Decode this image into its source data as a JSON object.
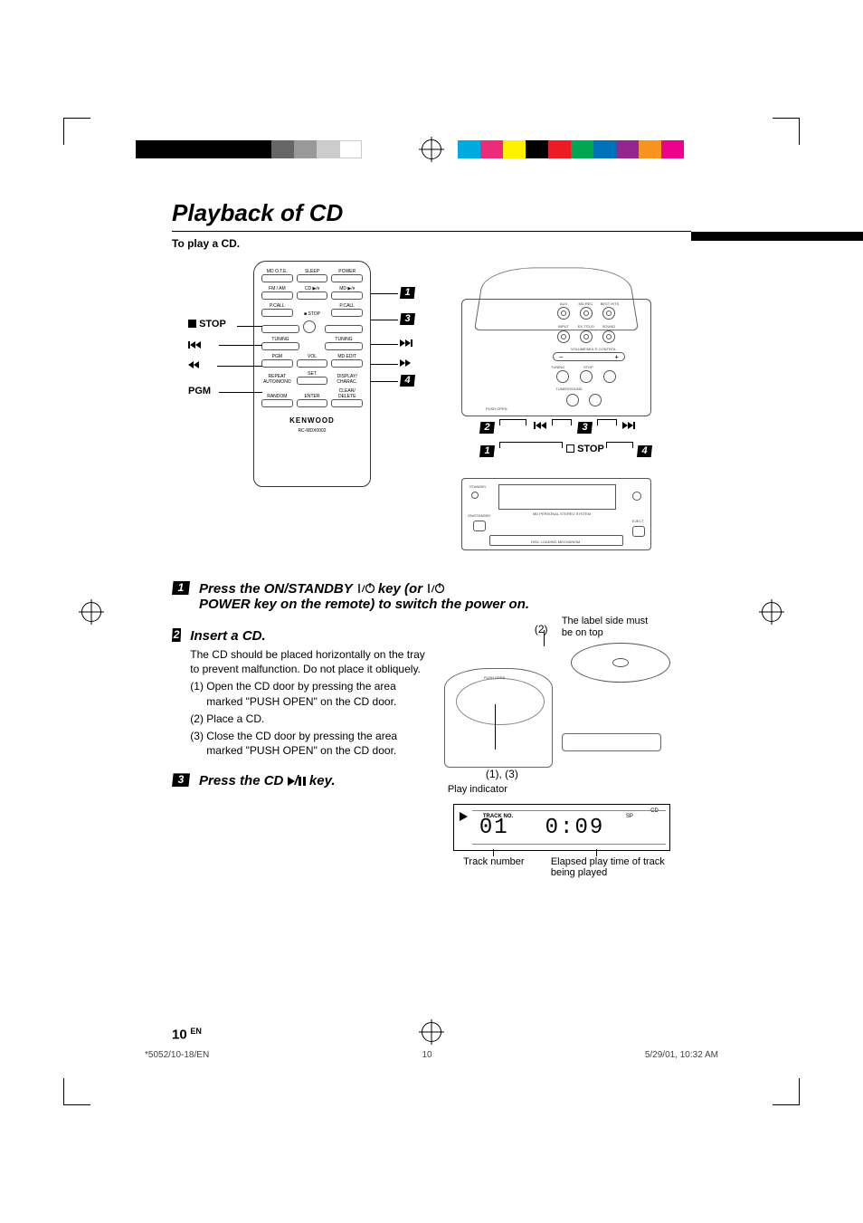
{
  "page_title": "Playback of CD",
  "intro": "To play a CD.",
  "callouts": {
    "stop": "STOP",
    "pgm": "PGM"
  },
  "remote": {
    "row1": [
      "MD O.T.E.",
      "SLEEP",
      "POWER"
    ],
    "row2": [
      "FM / AM",
      "CD ▶/⏸",
      "MD ▶/⏸"
    ],
    "row3_left": "P.CALL",
    "row3_right": "P.CALL",
    "row3_center": "■ STOP",
    "row4": [
      "TUNING",
      "TUNING"
    ],
    "row5": [
      "PGM",
      "VOL",
      "MD EDIT"
    ],
    "row6": [
      "REPEAT",
      "SET",
      "DISPLAY/"
    ],
    "row6b": [
      "AUTO/MONO",
      "",
      "CHARAC."
    ],
    "row7": [
      "RANDOM",
      "ENTER",
      "CLEAR/"
    ],
    "row7b": "DELETE",
    "brand": "KENWOOD",
    "model": "RC-MDX0002"
  },
  "unit": {
    "top_labels": [
      "AUX",
      "MD REC.",
      "BEST HITS",
      "INPUT",
      "EX.TITLE/",
      "SOUND"
    ],
    "volume": "VOLUME/MULTI CONTROL",
    "tuning": "TUNING",
    "stop_lbl": "STOP",
    "tuner_sound": "TUNER/SOUND",
    "push_open": "PUSH OPEN",
    "stop": "STOP",
    "front": [
      "STANDBY",
      "EJECT",
      "ON/STANDBY",
      "MD PERSONAL STEREO SYSTEM",
      "DISC LOADING MECHANISM"
    ]
  },
  "steps": {
    "s1": "Press the ON/STANDBY    key (or    POWER  key on the remote) to switch the power on.",
    "s1_a": "Press the ON/STANDBY",
    "s1_b": "key (or",
    "s1_c": "POWER  key on the remote) to switch the power on.",
    "s2_title": "Insert a CD.",
    "s2_p1": "The CD should be placed horizontally on the tray to prevent malfunction. Do not place it obliquely.",
    "s2_li1": "(1) Open the CD door by pressing the area marked \"PUSH OPEN\" on the CD door.",
    "s2_li2": "(2) Place a CD.",
    "s2_li3": "(3) Close the CD door by pressing the area marked \"PUSH OPEN\" on the CD door.",
    "s2_note": "The label side must be on top",
    "s2_ref2": "(2)",
    "s2_ref13": "(1), (3)",
    "s3_a": "Press the CD",
    "s3_b": "key.",
    "display": {
      "play_indicator": "Play indicator",
      "track_no_lbl": "TRACK NO.",
      "sp": "SP",
      "cd": "CD",
      "track_no": "01",
      "time": "0:09",
      "cap_left": "Track number",
      "cap_right": "Elapsed play time of track being played"
    }
  },
  "page_number": "10",
  "page_lang": "EN",
  "footer": {
    "left": "*5052/10-18/EN",
    "center": "10",
    "right": "5/29/01, 10:32 AM"
  },
  "colors": {
    "left_bar": [
      "#000",
      "#000",
      "#000",
      "#000",
      "#000",
      "#000",
      "#666",
      "#999",
      "#ccc",
      "#fff"
    ],
    "right_bar": [
      "#00a9e0",
      "#ee2a7b",
      "#fff200",
      "#000",
      "#ed1c24",
      "#00a651",
      "#0072bc",
      "#92278f",
      "#f7941d",
      "#ec008c"
    ]
  }
}
